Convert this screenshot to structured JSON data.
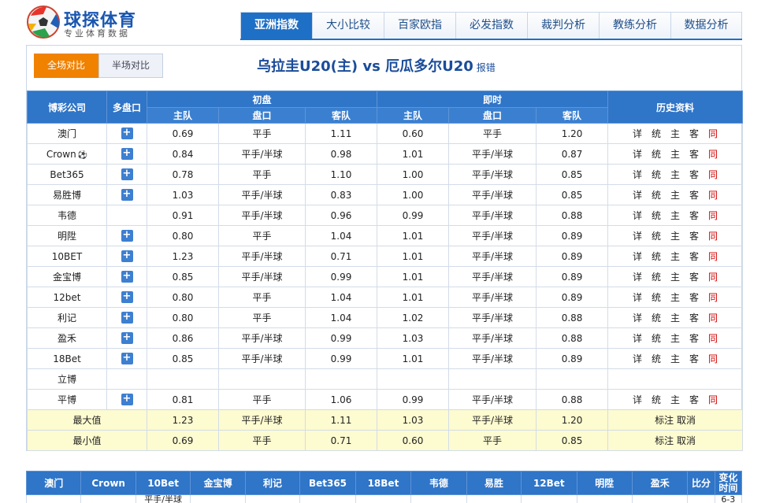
{
  "brand": {
    "name": "球探体育",
    "tagline": "专业体育数据"
  },
  "nav": [
    "亚洲指数",
    "大小比较",
    "百家欧指",
    "必发指数",
    "裁判分析",
    "教练分析",
    "数据分析"
  ],
  "toggle": {
    "full": "全场对比",
    "half": "半场对比"
  },
  "match": {
    "title": "乌拉圭U20(主) vs 厄瓜多尔U20",
    "report": "报错"
  },
  "headers": {
    "company": "博彩公司",
    "multi": "多盘口",
    "initial": "初盘",
    "live": "即时",
    "history": "历史资料",
    "home": "主队",
    "line": "盘口",
    "away": "客队"
  },
  "history_links": [
    "详",
    "统",
    "主",
    "客",
    "同"
  ],
  "rows": [
    {
      "company": "澳门",
      "plus": true,
      "i": [
        "0.69",
        "平手",
        "1.11"
      ],
      "l": [
        "0.60",
        "平手",
        "1.20"
      ],
      "hist": true
    },
    {
      "company": "Crown",
      "crown": true,
      "plus": true,
      "i": [
        "0.84",
        "平手/半球",
        "0.98"
      ],
      "l": [
        "1.01",
        "平手/半球",
        "0.87"
      ],
      "hist": true
    },
    {
      "company": "Bet365",
      "plus": true,
      "i": [
        "0.78",
        "平手",
        "1.10"
      ],
      "l": [
        "1.00",
        "平手/半球",
        "0.85"
      ],
      "hist": true
    },
    {
      "company": "易胜博",
      "plus": true,
      "i": [
        "1.03",
        "平手/半球",
        "0.83"
      ],
      "l": [
        "1.00",
        "平手/半球",
        "0.85"
      ],
      "hist": true
    },
    {
      "company": "韦德",
      "plus": false,
      "i": [
        "0.91",
        "平手/半球",
        "0.96"
      ],
      "l": [
        "0.99",
        "平手/半球",
        "0.88"
      ],
      "hist": true
    },
    {
      "company": "明陞",
      "plus": true,
      "i": [
        "0.80",
        "平手",
        "1.04"
      ],
      "l": [
        "1.01",
        "平手/半球",
        "0.89"
      ],
      "hist": true
    },
    {
      "company": "10BET",
      "plus": true,
      "i": [
        "1.23",
        "平手/半球",
        "0.71"
      ],
      "l": [
        "1.01",
        "平手/半球",
        "0.89"
      ],
      "hist": true
    },
    {
      "company": "金宝博",
      "plus": true,
      "i": [
        "0.85",
        "平手/半球",
        "0.99"
      ],
      "l": [
        "1.01",
        "平手/半球",
        "0.89"
      ],
      "hist": true
    },
    {
      "company": "12bet",
      "plus": true,
      "i": [
        "0.80",
        "平手",
        "1.04"
      ],
      "l": [
        "1.01",
        "平手/半球",
        "0.89"
      ],
      "hist": true
    },
    {
      "company": "利记",
      "plus": true,
      "i": [
        "0.80",
        "平手",
        "1.04"
      ],
      "l": [
        "1.02",
        "平手/半球",
        "0.88"
      ],
      "hist": true
    },
    {
      "company": "盈禾",
      "plus": true,
      "i": [
        "0.86",
        "平手/半球",
        "0.99"
      ],
      "l": [
        "1.03",
        "平手/半球",
        "0.88"
      ],
      "hist": true
    },
    {
      "company": "18Bet",
      "plus": true,
      "i": [
        "0.85",
        "平手/半球",
        "0.99"
      ],
      "l": [
        "1.01",
        "平手/半球",
        "0.89"
      ],
      "hist": true
    },
    {
      "company": "立博",
      "plus": false,
      "i": [
        "",
        "",
        ""
      ],
      "l": [
        "",
        "",
        ""
      ],
      "hist": false
    },
    {
      "company": "平博",
      "plus": true,
      "i": [
        "0.81",
        "平手",
        "1.06"
      ],
      "l": [
        "0.99",
        "平手/半球",
        "0.88"
      ],
      "hist": true
    }
  ],
  "summary": [
    {
      "label": "最大值",
      "i": [
        "1.23",
        "平手/半球",
        "1.11"
      ],
      "l": [
        "1.03",
        "平手/半球",
        "1.20"
      ]
    },
    {
      "label": "最小值",
      "i": [
        "0.69",
        "平手",
        "0.71"
      ],
      "l": [
        "0.60",
        "平手",
        "0.85"
      ]
    }
  ],
  "summary_actions": {
    "mark": "标注",
    "cancel": "取消"
  },
  "bottom": {
    "headers": [
      "澳门",
      "Crown",
      "10Bet",
      "金宝博",
      "利记",
      "Bet365",
      "18Bet",
      "韦德",
      "易胜",
      "12Bet",
      "明陞",
      "盈禾",
      "比分",
      "变化时间"
    ],
    "cell_10bet": "平手/半球",
    "time_cell": "6-3"
  },
  "colors": {
    "accent": "#1e6fc6",
    "header_bg": "#2f75c8",
    "active_toggle": "#f08200",
    "highlight_row": "#fdfbd0",
    "same_link": "#d10000"
  }
}
